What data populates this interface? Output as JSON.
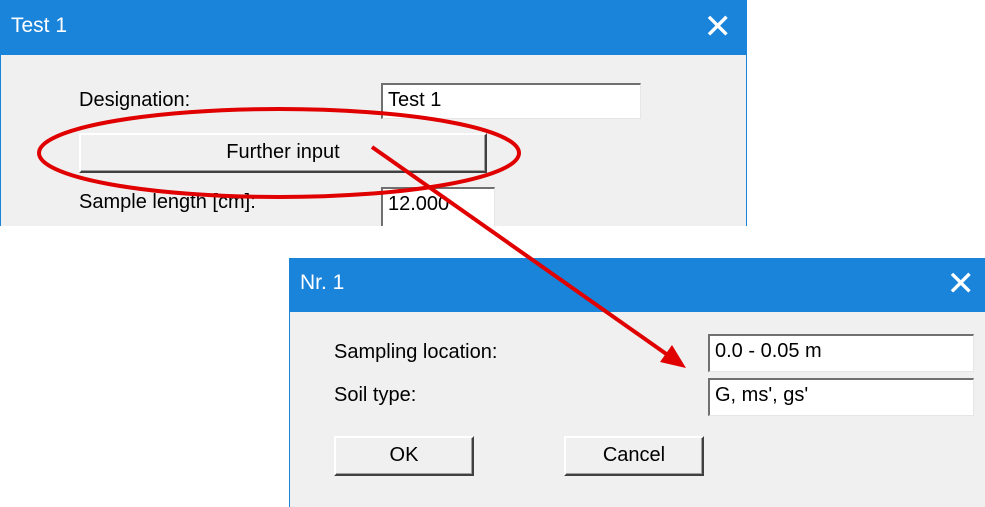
{
  "dialog1": {
    "title": "Test 1",
    "close_glyph": "✕",
    "designation_label": "Designation:",
    "designation_value": "Test 1",
    "further_input_label": "Further input",
    "sample_length_label": "Sample length [cm]:",
    "sample_length_value": "12.000"
  },
  "dialog2": {
    "title": "Nr. 1",
    "close_glyph": "✕",
    "sampling_location_label": "Sampling location:",
    "sampling_location_value": "0.0 - 0.05 m",
    "soil_type_label": "Soil type:",
    "soil_type_value": "G, ms', gs'",
    "ok_label": "OK",
    "cancel_label": "Cancel"
  },
  "colors": {
    "titlebar": "#1a84db",
    "dialog_bg": "#f0f0f0",
    "annotation": "#e00000"
  }
}
